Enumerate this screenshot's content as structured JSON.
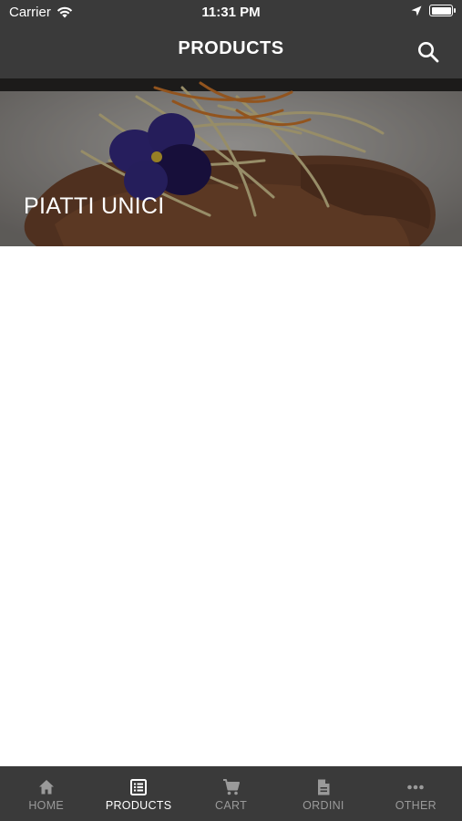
{
  "status_bar": {
    "carrier": "Carrier",
    "time": "11:31 PM"
  },
  "navbar": {
    "title": "PRODUCTS"
  },
  "categories": [
    {
      "label": "PIATTI UNICI"
    }
  ],
  "tabbar": {
    "tabs": [
      {
        "label": "HOME",
        "icon": "home-icon",
        "active": false
      },
      {
        "label": "PRODUCTS",
        "icon": "list-icon",
        "active": true
      },
      {
        "label": "CART",
        "icon": "cart-icon",
        "active": false
      },
      {
        "label": "ORDINI",
        "icon": "document-icon",
        "active": false
      },
      {
        "label": "OTHER",
        "icon": "more-icon",
        "active": false
      }
    ]
  },
  "colors": {
    "bar_background": "#3a3a3a",
    "active_tab": "#ffffff",
    "inactive_tab": "#9a9a9a"
  }
}
